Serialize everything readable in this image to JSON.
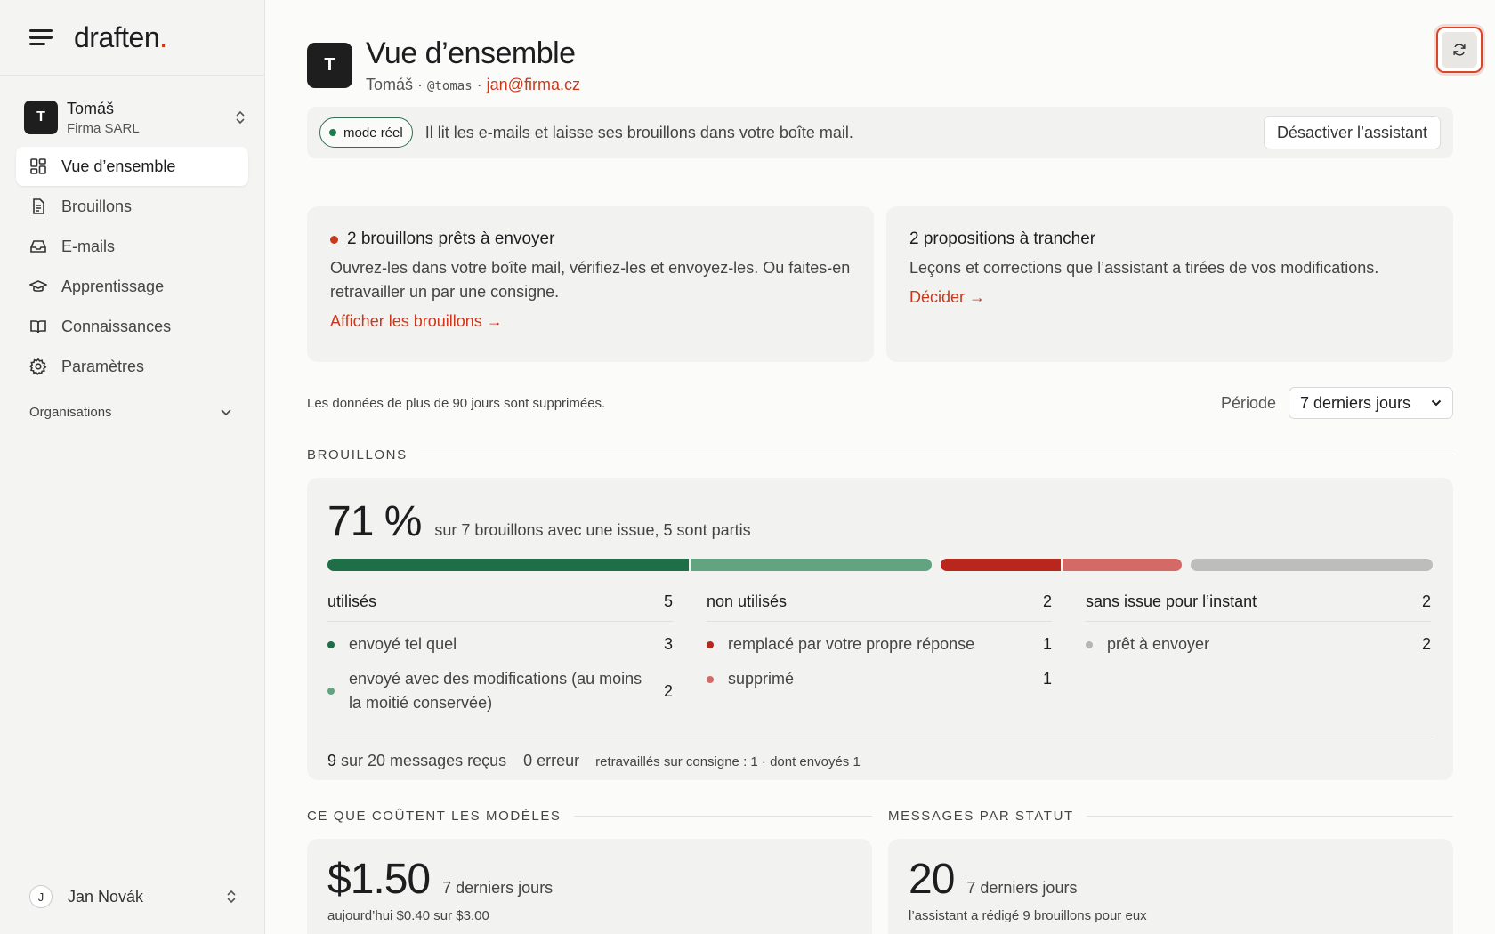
{
  "sidebar": {
    "logo_text": "draften",
    "logo_dot": ".",
    "account": {
      "initial": "T",
      "name": "Tomáš",
      "org": "Firma SARL"
    },
    "nav": [
      {
        "label": "Vue d’ensemble",
        "icon": "grid-icon",
        "active": true
      },
      {
        "label": "Brouillons",
        "icon": "document-icon"
      },
      {
        "label": "E-mails",
        "icon": "inbox-icon"
      },
      {
        "label": "Apprentissage",
        "icon": "graduation-cap-icon"
      },
      {
        "label": "Connaissances",
        "icon": "book-icon"
      },
      {
        "label": "Paramètres",
        "icon": "gear-icon"
      }
    ],
    "organisations_label": "Organisations",
    "user": {
      "initial": "J",
      "name": "Jan Novák"
    }
  },
  "header": {
    "initial": "T",
    "title": "Vue d’ensemble",
    "name": "Tomáš",
    "separator": "·",
    "handle": "@tomas",
    "email": "jan@firma.cz"
  },
  "banner": {
    "mode": "mode réel",
    "text": "Il lit les e-mails et laisse ses brouillons dans votre boîte mail.",
    "button": "Désactiver l’assistant"
  },
  "cards": {
    "drafts": {
      "title": "2 brouillons prêts à envoyer",
      "text": "Ouvrez-les dans votre boîte mail, vérifiez-les et envoyez-les. Ou faites-en retravailler un par une consigne.",
      "link": "Afficher les brouillons →"
    },
    "proposals": {
      "title": "2 propositions à trancher",
      "text": "Leçons et corrections que l’assistant a tirées de vos modifications.",
      "link": "Décider →"
    }
  },
  "retention_note": "Les données de plus de 90 jours sont supprimées.",
  "period": {
    "label": "Période",
    "selected": "7 derniers jours"
  },
  "brouillons": {
    "section_label": "BROUILLONS",
    "percent": "71 %",
    "percent_sub": "sur 7 brouillons avec une issue, 5 sont partis",
    "bar": [
      {
        "group": "utilisés",
        "segments": [
          {
            "value": 3,
            "color": "#1e6e48"
          },
          {
            "value": 2,
            "color": "#63a480"
          }
        ]
      },
      {
        "group": "non utilisés",
        "segments": [
          {
            "value": 1,
            "color": "#b8261c"
          },
          {
            "value": 1,
            "color": "#d46a66"
          }
        ]
      },
      {
        "group": "sans issue",
        "segments": [
          {
            "value": 2,
            "color": "#bdbdbb"
          }
        ]
      }
    ],
    "columns": [
      {
        "title": "utilisés",
        "count": "5",
        "items": [
          {
            "label": "envoyé tel quel",
            "count": "3",
            "color": "#1e6e48"
          },
          {
            "label": "envoyé avec des modifications (au moins la moitié conservée)",
            "count": "2",
            "color": "#63a480"
          }
        ]
      },
      {
        "title": "non utilisés",
        "count": "2",
        "items": [
          {
            "label": "remplacé par votre propre réponse",
            "count": "1",
            "color": "#b8261c"
          },
          {
            "label": "supprimé",
            "count": "1",
            "color": "#d46a66"
          }
        ]
      },
      {
        "title": "sans issue pour l’instant",
        "count": "2",
        "items": [
          {
            "label": "prêt à envoyer",
            "count": "2",
            "color": "#b5b5b3"
          }
        ]
      }
    ],
    "stats": {
      "received_num": "9",
      "received_text": "sur 20 messages reçus",
      "errors": "0 erreur",
      "reworked": "retravaillés sur consigne : 1 · dont envoyés 1"
    }
  },
  "costs": {
    "section_label": "CE QUE COÛTENT LES MODÈLES",
    "amount": "$1.50",
    "period": "7 derniers jours",
    "sub": "aujourd’hui $0.40 sur $3.00"
  },
  "messages": {
    "section_label": "MESSAGES PAR STATUT",
    "count": "20",
    "period": "7 derniers jours",
    "sub": "l’assistant a rédigé 9 brouillons pour eux"
  }
}
